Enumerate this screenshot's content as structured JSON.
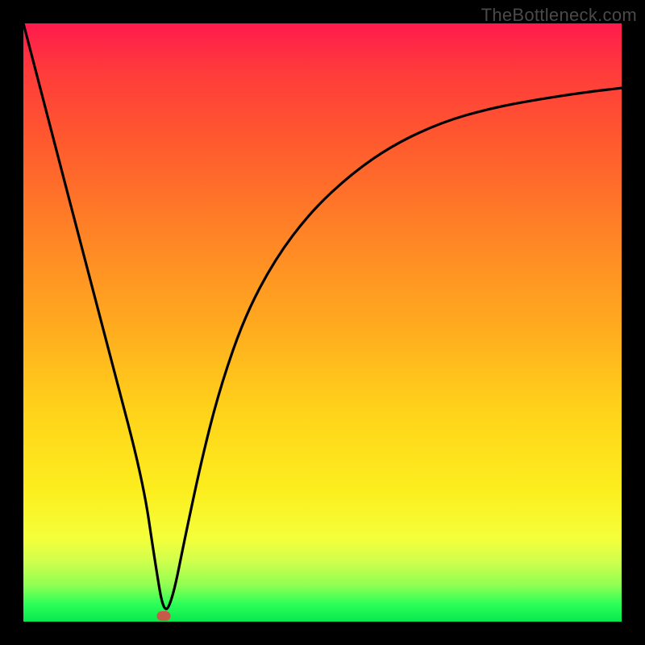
{
  "watermark": "TheBottleneck.com",
  "chart_data": {
    "type": "line",
    "title": "",
    "xlabel": "",
    "ylabel": "",
    "xlim": [
      0,
      100
    ],
    "ylim": [
      0,
      100
    ],
    "grid": false,
    "annotations": [],
    "series": [
      {
        "name": "curve",
        "x": [
          0,
          5,
          10,
          15,
          20,
          22,
          23.5,
          25,
          27,
          30,
          33,
          37,
          42,
          48,
          55,
          62,
          70,
          78,
          86,
          94,
          100
        ],
        "y": [
          100,
          80.8,
          61.6,
          42.6,
          23.5,
          10.0,
          1.0,
          4.0,
          14.0,
          28.0,
          39.5,
          51.0,
          60.5,
          68.5,
          75.0,
          79.8,
          83.5,
          85.8,
          87.3,
          88.5,
          89.2
        ]
      }
    ],
    "marker": {
      "x": 23.5,
      "y": 1.0,
      "color": "#c85a4a"
    },
    "gradient_colors": {
      "top": "#ff1a4d",
      "mid_upper": "#ff8326",
      "mid": "#ffd31a",
      "mid_lower": "#f4ff3a",
      "bottom": "#07e84e"
    }
  }
}
